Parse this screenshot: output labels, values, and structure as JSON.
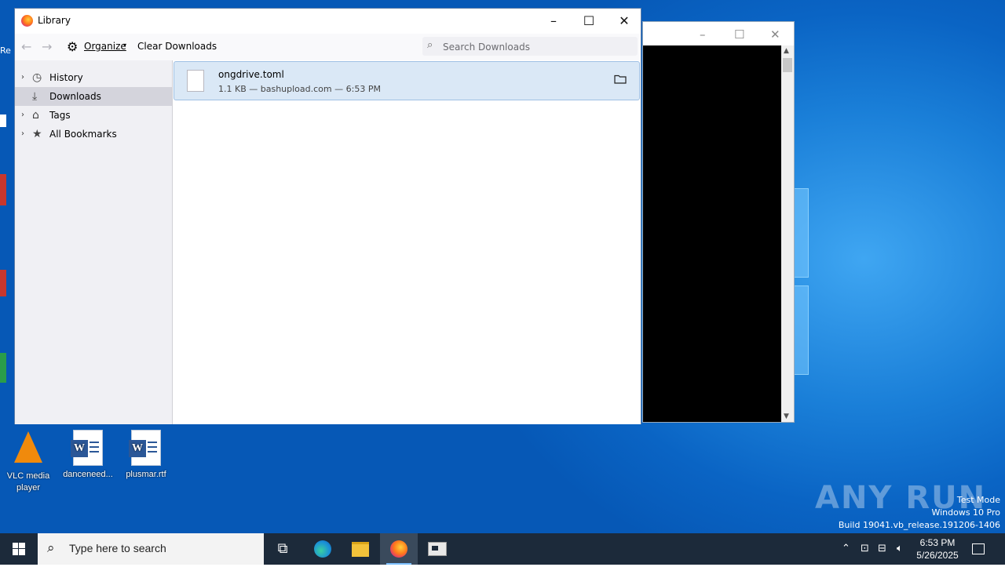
{
  "desktop": {
    "icons": [
      {
        "label": "VLC media player",
        "icon": "vlc-icon"
      },
      {
        "label": "danceneed...",
        "icon": "word-document-icon"
      },
      {
        "label": "plusmar.rtf",
        "icon": "word-document-icon"
      }
    ],
    "watermark": {
      "line1": "Test Mode",
      "line2": "Windows 10 Pro",
      "line3": "Build 19041.vb_release.191206-1406"
    },
    "brand": "ANY RUN",
    "edge_fragment": "Re"
  },
  "library_window": {
    "title": "Library",
    "toolbar": {
      "organize_label": "Organize",
      "clear_label": "Clear Downloads",
      "search_placeholder": "Search Downloads"
    },
    "sidebar": [
      {
        "label": "History",
        "icon": "clock-icon",
        "expandable": true
      },
      {
        "label": "Downloads",
        "icon": "download-icon",
        "expandable": false,
        "selected": true
      },
      {
        "label": "Tags",
        "icon": "tag-icon",
        "expandable": true
      },
      {
        "label": "All Bookmarks",
        "icon": "star-icon",
        "expandable": true
      }
    ],
    "downloads": [
      {
        "name": "ongdrive.toml",
        "meta": "1.1 KB — bashupload.com — 6:53 PM"
      }
    ]
  },
  "taskbar": {
    "search_placeholder": "Type here to search",
    "clock": {
      "time": "6:53 PM",
      "date": "5/26/2025"
    }
  },
  "colors": {
    "desktop_blue": "#0a64c4",
    "taskbar": "#1c2a3a",
    "selection": "#dae8f6"
  }
}
